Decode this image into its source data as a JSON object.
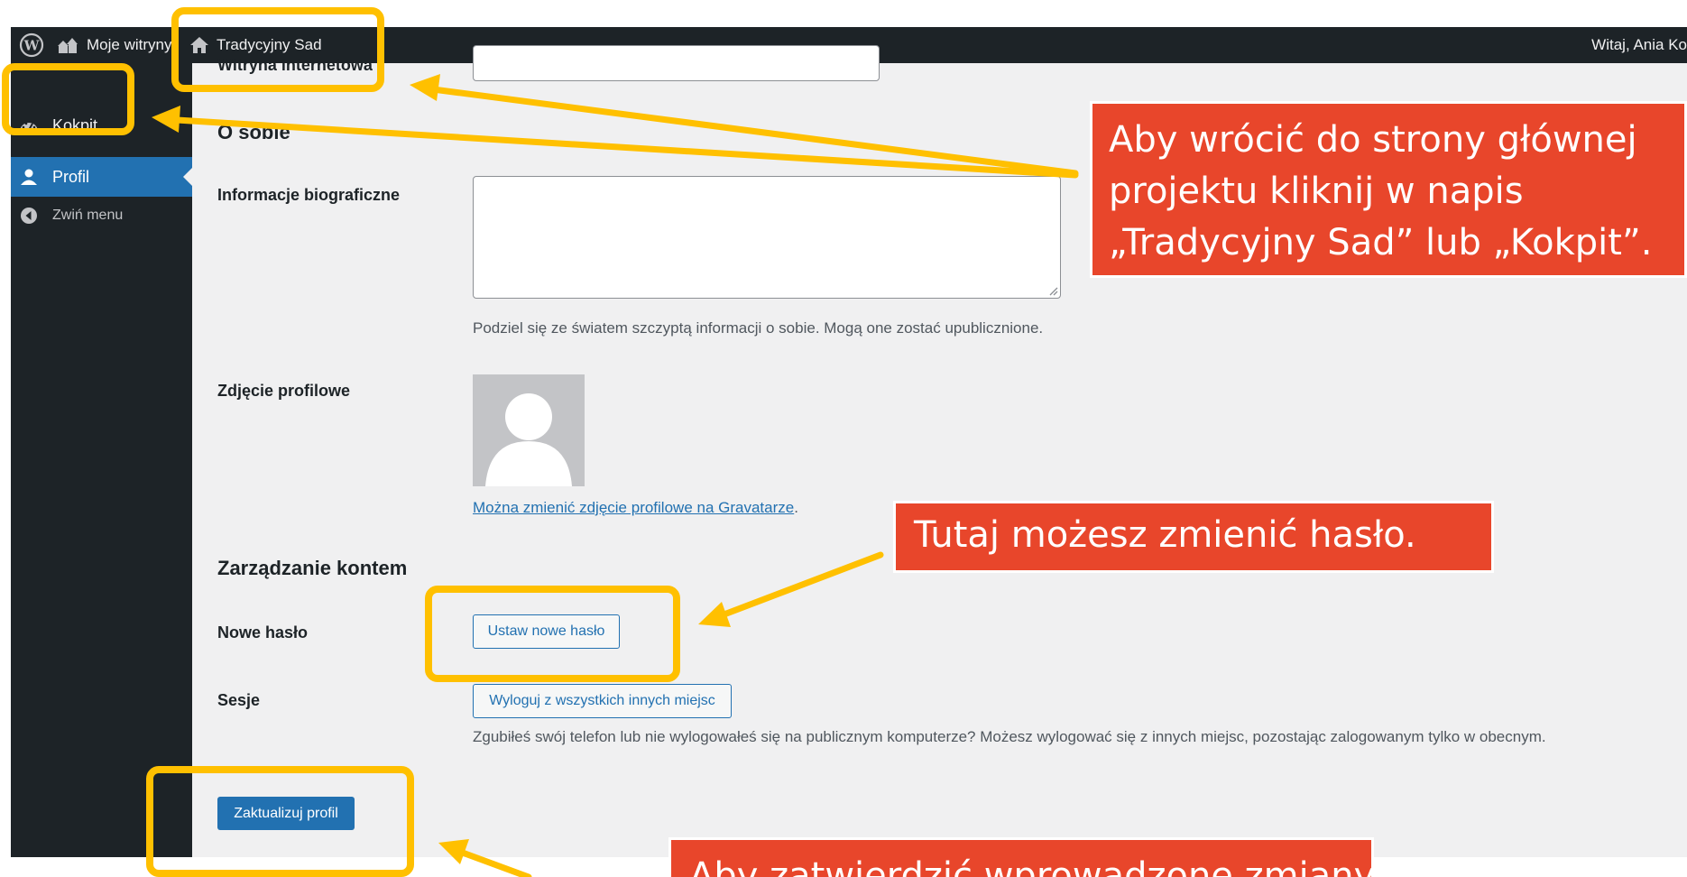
{
  "adminbar": {
    "my_sites": "Moje witryny",
    "site_name": "Tradycyjny Sad",
    "greeting": "Witaj, Ania Ko"
  },
  "sidebar": {
    "items": [
      {
        "label": "Kokpit",
        "icon": "dashboard-icon"
      },
      {
        "label": "Profil",
        "icon": "user-icon"
      },
      {
        "label": "Zwiń menu",
        "icon": "collapse-icon"
      }
    ]
  },
  "form": {
    "website_label": "Witryna internetowa",
    "about_title": "O sobie",
    "bio_label": "Informacje biograficzne",
    "bio_value": "",
    "bio_description": "Podziel się ze światem szczyptą informacji o sobie. Mogą one zostać upublicznione.",
    "picture_label": "Zdjęcie profilowe",
    "gravatar_link": "Można zmienić zdjęcie profilowe na Gravatarze",
    "gravatar_suffix": ".",
    "account_title": "Zarządzanie kontem",
    "new_password_label": "Nowe hasło",
    "new_password_button": "Ustaw nowe hasło",
    "sessions_label": "Sesje",
    "sessions_button": "Wyloguj z wszystkich innych miejsc",
    "sessions_description": "Zgubiłeś swój telefon lub nie wylogowałeś się na publicznym komputerze? Możesz wylogować się z innych miejsc, pozostając zalogowanym tylko w obecnym.",
    "update_button": "Zaktualizuj profil"
  },
  "callouts": {
    "home": [
      "Aby wrócić do strony głównej",
      "projektu kliknij w napis",
      "„Tradycyjny Sad” lub „Kokpit”."
    ],
    "password": "Tutaj możesz zmienić hasło.",
    "submit": "Aby zatwierdzić wprowadzone zmiany"
  },
  "colors": {
    "wp_blue": "#2271b1",
    "admin_dark": "#1d2327",
    "callout_red": "#e8462b",
    "highlight_yellow": "#ffc000"
  }
}
